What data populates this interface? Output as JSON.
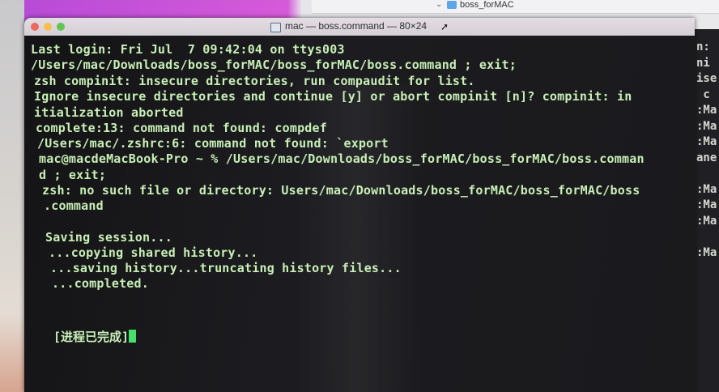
{
  "finder": {
    "folder_label": "boss_forMAC",
    "chevron": "⌄"
  },
  "window": {
    "title": "mac — boss.command — 80×24"
  },
  "terminal": {
    "lines": [
      "Last login: Fri Jul  7 09:42:04 on ttys003",
      "/Users/mac/Downloads/boss_forMAC/boss_forMAC/boss.command ; exit;",
      "zsh compinit: insecure directories, run compaudit for list.",
      "Ignore insecure directories and continue [y] or abort compinit [n]? compinit: in",
      "itialization aborted",
      "complete:13: command not found: compdef",
      "/Users/mac/.zshrc:6: command not found: `export",
      "mac@macdeMacBook-Pro ~ % /Users/mac/Downloads/boss_forMAC/boss_forMAC/boss.comman",
      "d ; exit;",
      "zsh: no such file or directory: Users/mac/Downloads/boss_forMAC/boss_forMAC/boss",
      ".command",
      "",
      "Saving session...",
      "...copying shared history...",
      "...saving history...truncating history files...",
      "...completed."
    ],
    "status": "[进程已完成]"
  },
  "background_window": {
    "lines": [
      "n:",
      "ni",
      "ise",
      " c",
      ":Ma",
      ":Ma",
      ":Ma",
      "ane",
      "",
      ":Ma",
      ":Ma",
      ":Ma",
      "",
      ":Ma"
    ]
  }
}
